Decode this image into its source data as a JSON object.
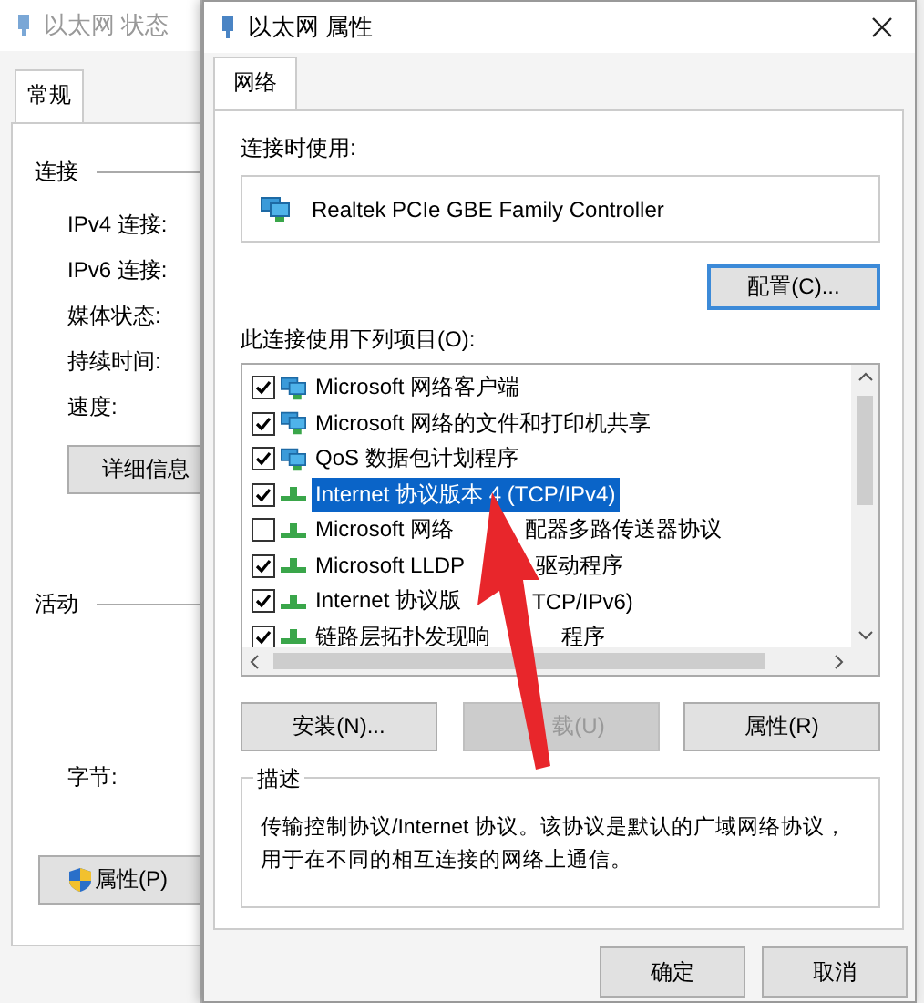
{
  "status_window": {
    "title": "以太网 状态",
    "tabs": [
      {
        "label": "常规",
        "selected": true
      }
    ],
    "connection_group": "连接",
    "fields": [
      "IPv4 连接:",
      "IPv6 连接:",
      "媒体状态:",
      "持续时间:",
      "速度:"
    ],
    "details_button": "详细信息",
    "activity_group": "活动",
    "bytes_label": "字节:",
    "properties_button": "属性(P)"
  },
  "properties_window": {
    "title": "以太网 属性",
    "tabs": [
      {
        "label": "网络",
        "selected": true
      }
    ],
    "connect_using_label": "连接时使用:",
    "adapter": "Realtek PCIe GBE Family Controller",
    "configure_button": "配置(C)...",
    "items_label": "此连接使用下列项目(O):",
    "items": [
      {
        "kind": "service",
        "label": "Microsoft 网络客户端",
        "checked": true,
        "selected": false
      },
      {
        "kind": "service",
        "label": "Microsoft 网络的文件和打印机共享",
        "checked": true,
        "selected": false
      },
      {
        "kind": "service",
        "label": "QoS 数据包计划程序",
        "checked": true,
        "selected": false
      },
      {
        "kind": "protocol",
        "label": "Internet 协议版本 4 (TCP/IPv4)",
        "checked": true,
        "selected": true
      },
      {
        "kind": "protocol",
        "label": "Microsoft 网络",
        "label_tail": "配器多路传送器协议",
        "checked": false,
        "selected": false
      },
      {
        "kind": "protocol",
        "label": "Microsoft LLDP",
        "label_tail": "驱动程序",
        "checked": true,
        "selected": false
      },
      {
        "kind": "protocol",
        "label": "Internet 协议版",
        "label_tail": "TCP/IPv6)",
        "checked": true,
        "selected": false
      },
      {
        "kind": "protocol",
        "label": "链路层拓扑发现响",
        "label_tail": "程序",
        "checked": true,
        "selected": false
      }
    ],
    "buttons": [
      {
        "label": "安装(N)...",
        "disabled": false
      },
      {
        "label": "载(U)",
        "disabled": true
      },
      {
        "label": "属性(R)",
        "disabled": false
      }
    ],
    "description_group": "描述",
    "description": "传输控制协议/Internet 协议。该协议是默认的广域网络协议，用于在不同的相互连接的网络上通信。",
    "dialog_buttons": [
      "确定",
      "取消"
    ]
  }
}
